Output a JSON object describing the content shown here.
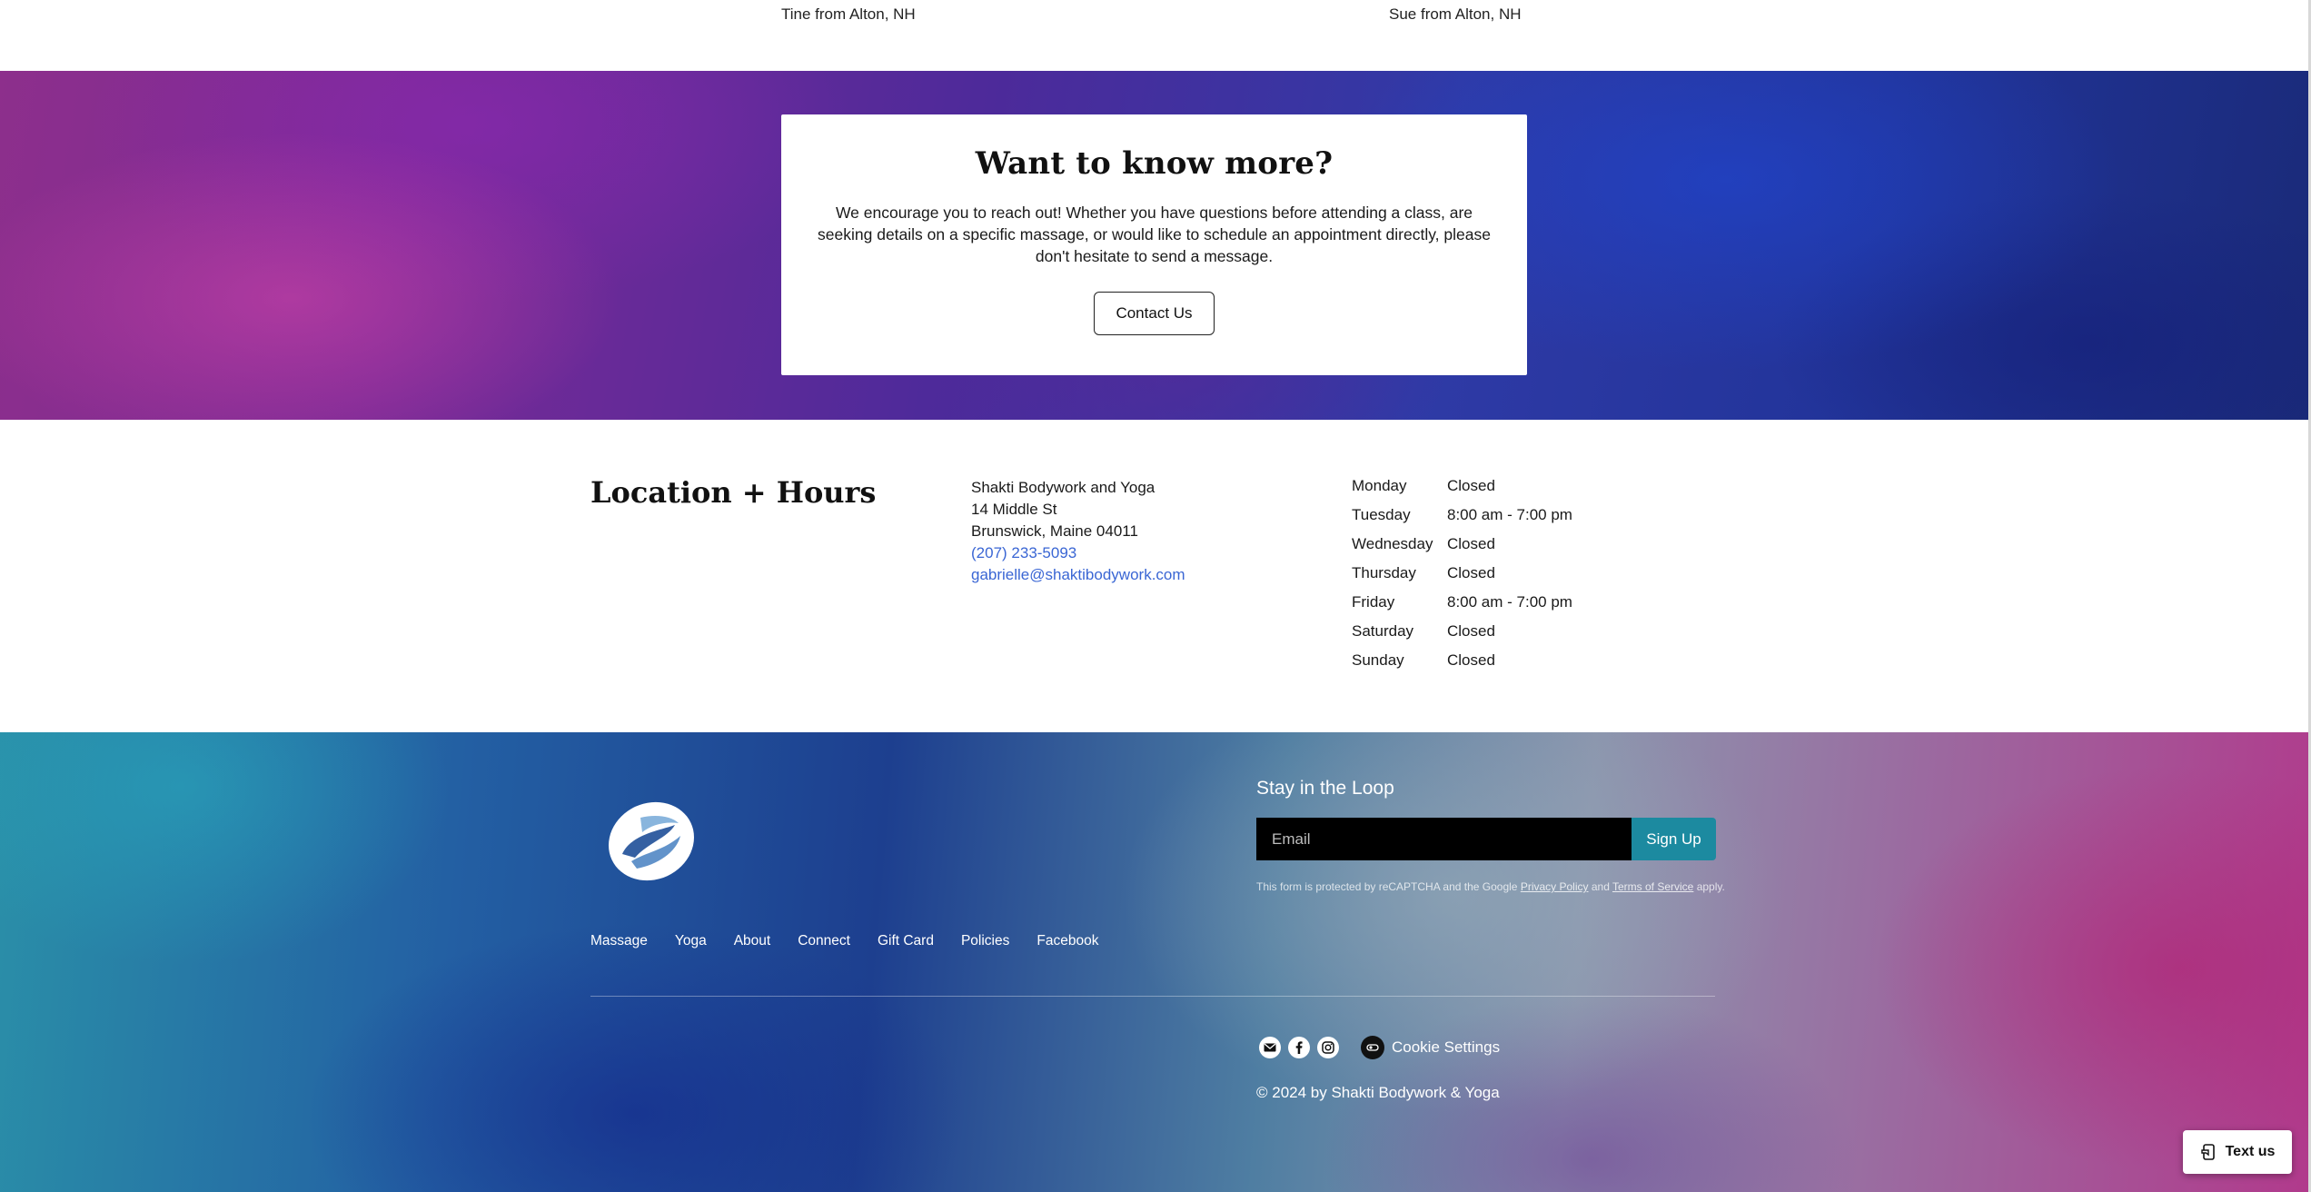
{
  "testimonials": {
    "left_credit": "Tine from Alton, NH",
    "right_credit": "Sue from Alton, NH"
  },
  "cta": {
    "heading": "Want to know more?",
    "body": "We encourage you to reach out! Whether you have questions before attending a class, are seeking details on a specific massage, or would like to schedule an appointment directly, please don't hesitate to send a message.",
    "button_label": "Contact Us"
  },
  "location": {
    "title": "Location + Hours",
    "business_name": "Shakti Bodywork and Yoga",
    "street": "14 Middle St",
    "city_line": "Brunswick, Maine 04011",
    "phone": "(207) 233-5093",
    "email": "gabrielle@shaktibodywork.com"
  },
  "hours": [
    {
      "day": "Monday",
      "time": "Closed"
    },
    {
      "day": "Tuesday",
      "time": "8:00 am - 7:00 pm"
    },
    {
      "day": "Wednesday",
      "time": "Closed"
    },
    {
      "day": "Thursday",
      "time": "Closed"
    },
    {
      "day": "Friday",
      "time": "8:00 am - 7:00 pm"
    },
    {
      "day": "Saturday",
      "time": "Closed"
    },
    {
      "day": "Sunday",
      "time": "Closed"
    }
  ],
  "footer": {
    "nav": [
      "Massage",
      "Yoga",
      "About",
      "Connect",
      "Gift Card",
      "Policies",
      "Facebook"
    ],
    "newsletter_heading": "Stay in the Loop",
    "email_placeholder": "Email",
    "signup_label": "Sign Up",
    "recaptcha_prefix": "This form is protected by reCAPTCHA and the Google",
    "privacy_link": "Privacy Policy",
    "recaptcha_and": "and",
    "terms_link": "Terms of Service",
    "recaptcha_suffix": "apply.",
    "social_icons": [
      "mail-icon",
      "facebook-icon",
      "instagram-icon"
    ],
    "cookie_settings": "Cookie Settings",
    "copyright": "© 2024 by Shakti Bodywork & Yoga",
    "signup_color": "#1c8aa0"
  },
  "text_us": "Text us",
  "colors": {
    "link": "#3a66d4",
    "email_bg": "#000000"
  }
}
